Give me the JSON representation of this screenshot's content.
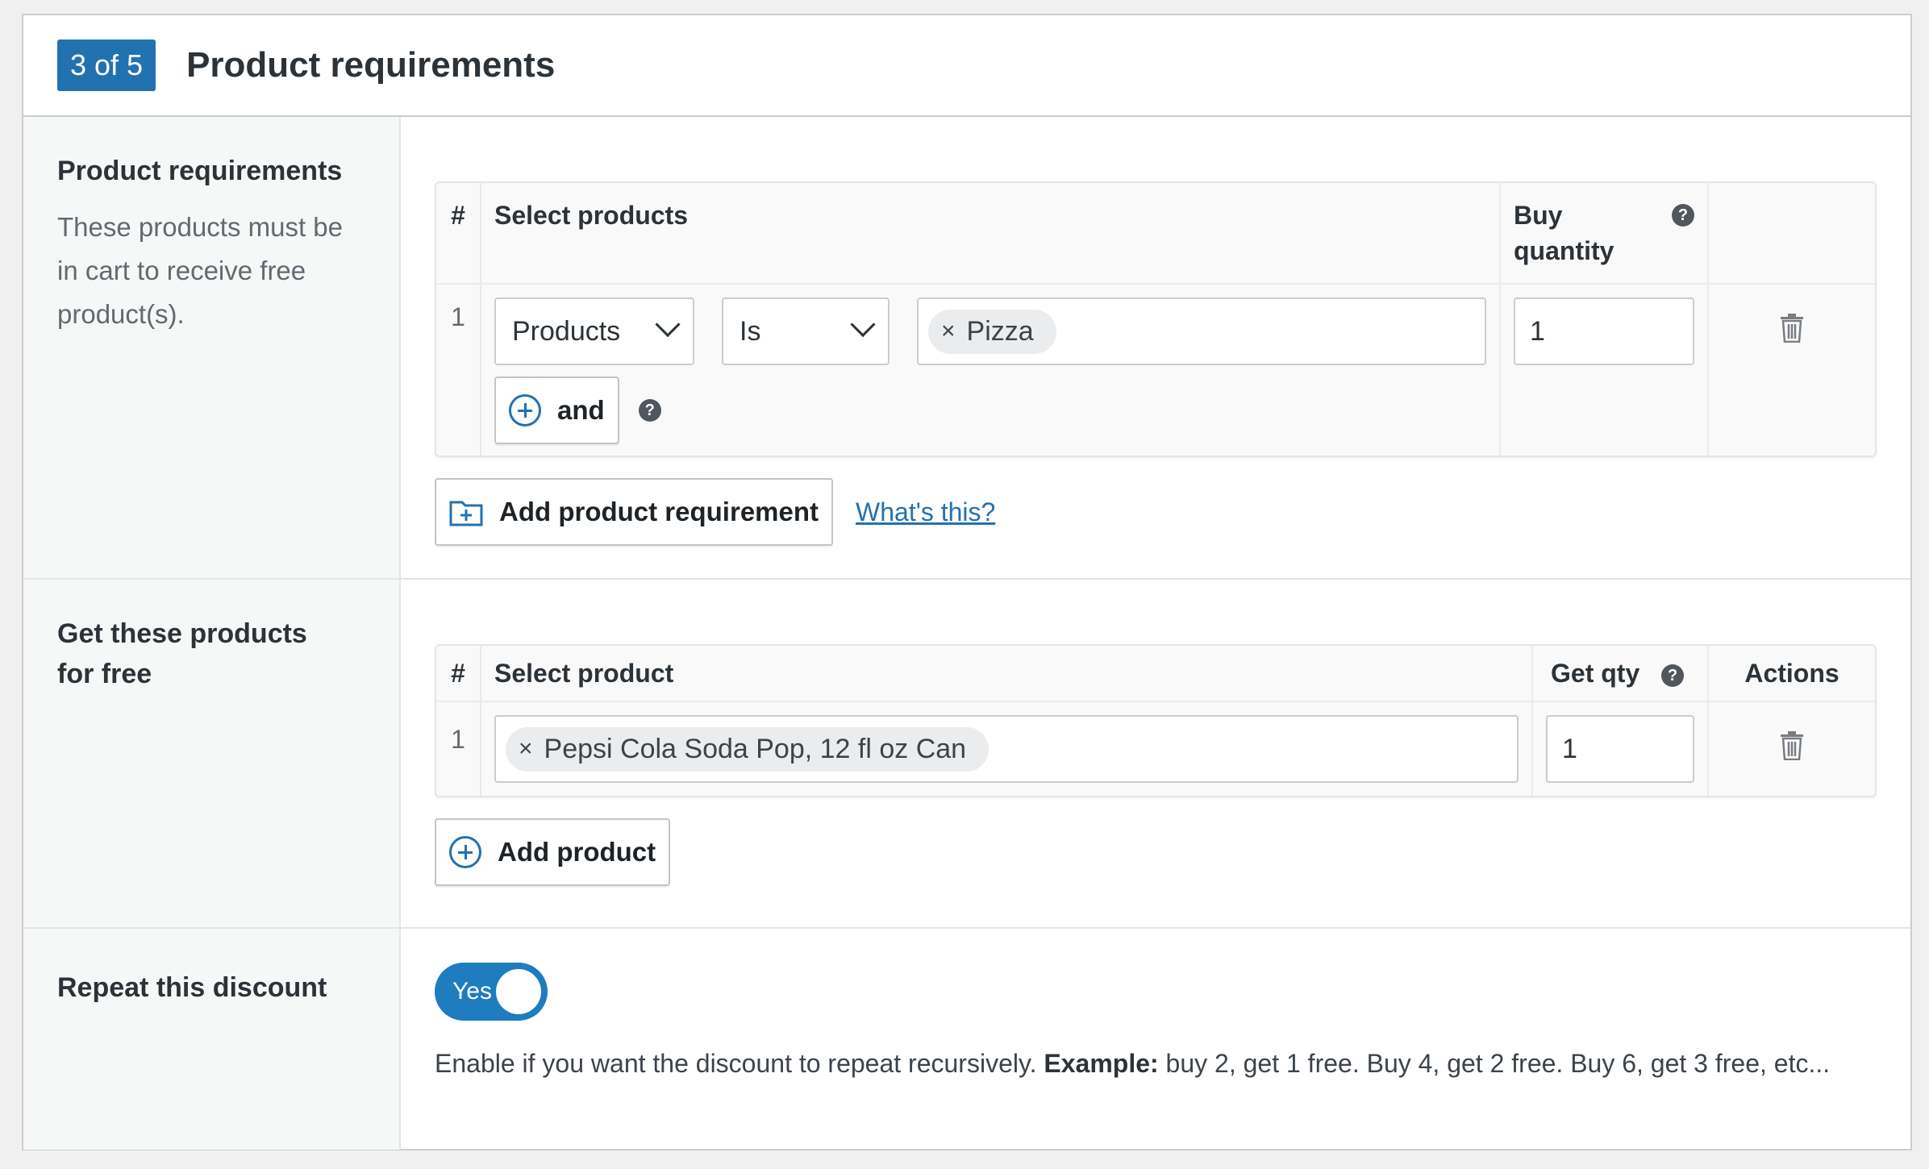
{
  "header": {
    "step": "3 of 5",
    "title": "Product requirements"
  },
  "requirements": {
    "label": "Product requirements",
    "description": "These products must be in cart to receive free product(s).",
    "table": {
      "col_index": "#",
      "col_select": "Select products",
      "col_qty": "Buy quantity",
      "rows": [
        {
          "index": "1",
          "type_select": "Products",
          "condition_select": "Is",
          "tag": "Pizza",
          "qty": "1",
          "and_label": "and"
        }
      ]
    },
    "add_button": "Add product requirement",
    "whats_this": "What's this?"
  },
  "free_products": {
    "label": "Get these products for free",
    "table": {
      "col_index": "#",
      "col_select": "Select product",
      "col_qty": "Get qty",
      "col_actions": "Actions",
      "rows": [
        {
          "index": "1",
          "tag": "Pepsi Cola Soda Pop, 12 fl oz Can",
          "qty": "1"
        }
      ]
    },
    "add_button": "Add product"
  },
  "repeat": {
    "label": "Repeat this discount",
    "toggle_label": "Yes",
    "toggle_on": true,
    "desc_text": "Enable if you want the discount to repeat recursively.",
    "desc_example_label": "Example:",
    "desc_example": "buy 2, get 1 free. Buy 4, get 2 free. Buy 6, get 3 free, etc..."
  },
  "colors": {
    "accent": "#2271b1",
    "toggle": "#1e7cbf"
  }
}
